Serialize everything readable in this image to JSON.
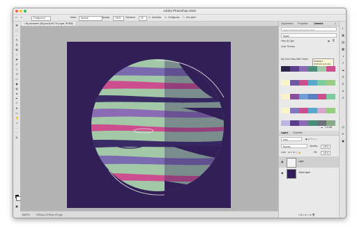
{
  "window": {
    "title": "Adobe Photoshop 2020",
    "traffic_colors": [
      "#fe5f57",
      "#febc2e",
      "#28c840"
    ]
  },
  "options_bar": {
    "preset": "Foreground",
    "mode_label": "Mode:",
    "mode_value": "Normal",
    "opacity_label": "Opacity:",
    "opacity_value": "100%",
    "tolerance_label": "Tolerance:",
    "tolerance_value": "32",
    "antialias_label": "Anti-alias",
    "contiguous_label": "Contiguous",
    "all_layers_label": "All Layers"
  },
  "document": {
    "tab_label": "My document (45).psd @ 66.7% (Layer, RGB/8)",
    "zoom": "66.67%",
    "dimensions": "2700 px x 2700 px (72 ppi)",
    "artboard_color": "#321f58"
  },
  "panel": {
    "tabs": [
      "Adjustments",
      "Properties",
      "Libraries"
    ],
    "active_tab": "Libraries",
    "search_placeholder": "Search Libraries and Adobe Stock",
    "library_name": "Space",
    "view_by_label": "View by Type",
    "color_themes_label": "Color Themes",
    "tooltip_lines": [
      "#DBE0F4",
      "RGB:219 224 244"
    ],
    "theme_name": "My Color Glow Side Theme",
    "size_label": "1.6 MB",
    "swatch_rows": [
      [
        "#2c2448",
        "#5b3f8c",
        "#8a6bb4",
        "#4c8c7a",
        "#a2c8a8",
        "#cc4e8e"
      ],
      [
        "#fbf3c8",
        "#6e58a6",
        "#cc4e8e",
        "#5aa7c7",
        "#7ecb9f",
        "#9acd84"
      ],
      [
        "#fbf3c8",
        "#8a4e9c",
        "#6e9fd4",
        "#5c7fc1",
        "#cc4e8e",
        "#7ecb9f"
      ],
      [
        "#fbf3c8",
        "#8478bc",
        "#cc4e8e",
        "#5aa7c7",
        "#d4a6d0",
        "#9acd84"
      ],
      [
        "#bcb6e2",
        "#5b3f8c",
        "#8a6bb4",
        "#4c8c7a",
        "#6a707c",
        "#88aa88"
      ]
    ]
  },
  "layers_panel": {
    "tabs": [
      "Layers",
      "Channels"
    ],
    "kind_label": "Kind",
    "blend_mode": "Normal",
    "opacity_label": "Opacity:",
    "opacity_value": "100%",
    "lock_label": "Lock:",
    "fill_label": "Fill:",
    "fill_value": "100%",
    "layers": [
      {
        "name": "Layer",
        "selected": true
      },
      {
        "name": "Vector layer",
        "selected": false
      }
    ]
  }
}
